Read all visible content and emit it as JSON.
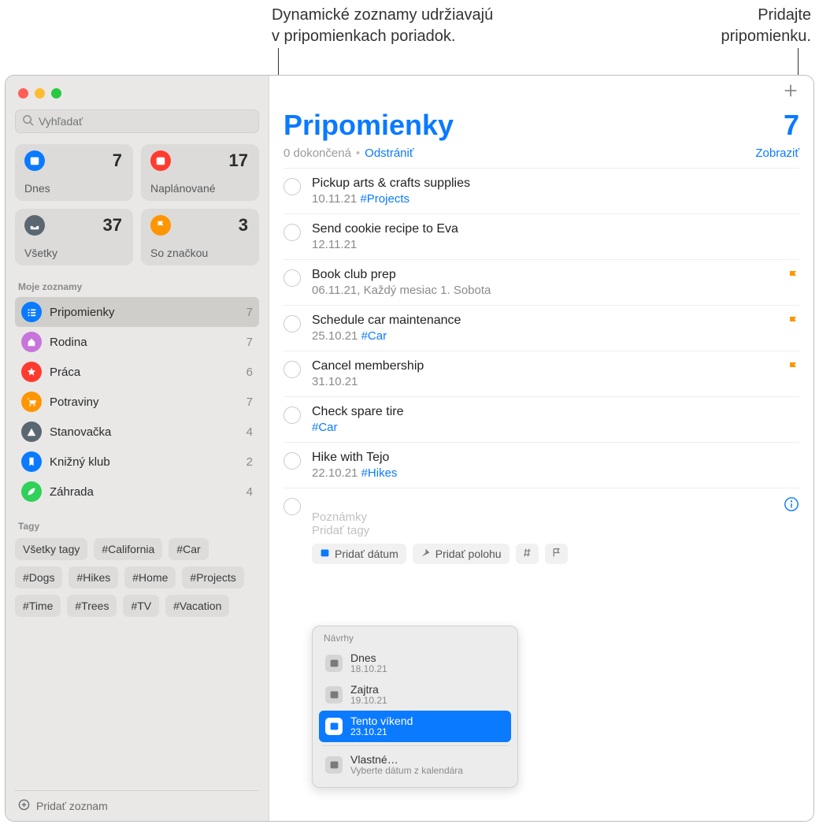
{
  "callouts": {
    "smart_lists": "Dynamické zoznamy udržiavajú\nv pripomienkach poriadok.",
    "add_reminder": "Pridajte\npripomienku."
  },
  "search": {
    "placeholder": "Vyhľadať"
  },
  "smart_tiles": [
    {
      "id": "today",
      "label": "Dnes",
      "count": 7,
      "color": "#0a7aff"
    },
    {
      "id": "scheduled",
      "label": "Naplánované",
      "count": 17,
      "color": "#ff3b30"
    },
    {
      "id": "all",
      "label": "Všetky",
      "count": 37,
      "color": "#5b6770"
    },
    {
      "id": "flagged",
      "label": "So značkou",
      "count": 3,
      "color": "#ff9500"
    }
  ],
  "sidebar": {
    "my_lists_label": "Moje zoznamy",
    "lists": [
      {
        "id": "reminders",
        "label": "Pripomienky",
        "count": 7,
        "color": "#0a7aff",
        "selected": true,
        "icon": "list"
      },
      {
        "id": "family",
        "label": "Rodina",
        "count": 7,
        "color": "#c774dc",
        "selected": false,
        "icon": "home"
      },
      {
        "id": "work",
        "label": "Práca",
        "count": 6,
        "color": "#ff3b30",
        "selected": false,
        "icon": "star"
      },
      {
        "id": "groceries",
        "label": "Potraviny",
        "count": 7,
        "color": "#ff9500",
        "selected": false,
        "icon": "cart"
      },
      {
        "id": "camping",
        "label": "Stanovačka",
        "count": 4,
        "color": "#5b6770",
        "selected": false,
        "icon": "tent"
      },
      {
        "id": "bookclub",
        "label": "Knižný klub",
        "count": 2,
        "color": "#0a7aff",
        "selected": false,
        "icon": "bookmark"
      },
      {
        "id": "garden",
        "label": "Záhrada",
        "count": 4,
        "color": "#30d158",
        "selected": false,
        "icon": "leaf"
      }
    ],
    "tags_label": "Tagy",
    "tags": [
      "Všetky tagy",
      "#California",
      "#Car",
      "#Dogs",
      "#Hikes",
      "#Home",
      "#Projects",
      "#Time",
      "#Trees",
      "#TV",
      "#Vacation"
    ],
    "add_list_label": "Pridať zoznam"
  },
  "main": {
    "title": "Pripomienky",
    "count": 7,
    "completed_text": "0 dokončená",
    "delete_label": "Odstrániť",
    "show_label": "Zobraziť",
    "items": [
      {
        "title": "Pickup arts & crafts supplies",
        "sub": "10.11.21",
        "tag": "#Projects",
        "flag": false
      },
      {
        "title": "Send cookie recipe to Eva",
        "sub": "12.11.21",
        "tag": "",
        "flag": false
      },
      {
        "title": "Book club prep",
        "sub": "06.11.21, Každý mesiac 1. Sobota",
        "tag": "",
        "flag": true
      },
      {
        "title": "Schedule car maintenance",
        "sub": "25.10.21",
        "tag": "#Car",
        "flag": true
      },
      {
        "title": "Cancel membership",
        "sub": "31.10.21",
        "tag": "",
        "flag": true
      },
      {
        "title": "Check spare tire",
        "sub": "",
        "tag": "#Car",
        "flag": false
      },
      {
        "title": "Hike with Tejo",
        "sub": "22.10.21",
        "tag": "#Hikes",
        "flag": false
      }
    ],
    "new_item": {
      "notes_placeholder": "Poznámky",
      "tags_placeholder": "Pridať tagy",
      "add_date_label": "Pridať dátum",
      "add_location_label": "Pridať polohu"
    },
    "suggestions": {
      "title": "Návrhy",
      "rows": [
        {
          "label": "Dnes",
          "sub": "18.10.21",
          "selected": false
        },
        {
          "label": "Zajtra",
          "sub": "19.10.21",
          "selected": false
        },
        {
          "label": "Tento víkend",
          "sub": "23.10.21",
          "selected": true
        }
      ],
      "custom": {
        "label": "Vlastné…",
        "sub": "Vyberte dátum z kalendára"
      }
    }
  }
}
